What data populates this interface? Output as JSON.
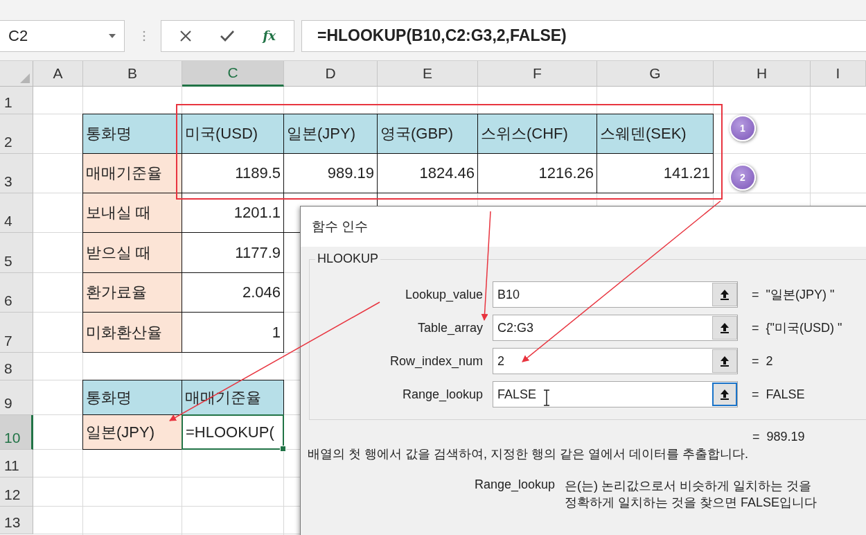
{
  "name_box": "C2",
  "formula_bar": {
    "function_label": "fx",
    "formula": "=HLOOKUP(B10,C2:G3,2,FALSE)"
  },
  "columns": [
    {
      "label": "A",
      "selected": false
    },
    {
      "label": "B",
      "selected": false
    },
    {
      "label": "C",
      "selected": true
    },
    {
      "label": "D",
      "selected": false
    },
    {
      "label": "E",
      "selected": false
    },
    {
      "label": "F",
      "selected": false
    },
    {
      "label": "G",
      "selected": false
    },
    {
      "label": "H",
      "selected": false
    },
    {
      "label": "I",
      "selected": false
    }
  ],
  "rows": [
    {
      "label": "1",
      "selected": false
    },
    {
      "label": "2",
      "selected": false,
      "cells": [
        {
          "kind": "head",
          "text": "통화명"
        },
        {
          "kind": "head",
          "text": "미국(USD)"
        },
        {
          "kind": "head",
          "text": "일본(JPY)"
        },
        {
          "kind": "head",
          "text": "영국(GBP)"
        },
        {
          "kind": "head",
          "text": "스위스(CHF)"
        },
        {
          "kind": "head",
          "text": "스웨덴(SEK)"
        }
      ]
    },
    {
      "label": "3",
      "selected": false,
      "cells": [
        {
          "kind": "label",
          "text": "매매기준율"
        },
        {
          "kind": "number",
          "text": "1189.5"
        },
        {
          "kind": "number",
          "text": "989.19"
        },
        {
          "kind": "number",
          "text": "1824.46"
        },
        {
          "kind": "number",
          "text": "1216.26"
        },
        {
          "kind": "number",
          "text": "141.21"
        }
      ]
    },
    {
      "label": "4",
      "selected": false,
      "cells": [
        {
          "kind": "label",
          "text": "보내실 때"
        },
        {
          "kind": "number",
          "text": "1201.1"
        },
        {
          "kind": "number"
        }
      ]
    },
    {
      "label": "5",
      "selected": false,
      "cells": [
        {
          "kind": "label",
          "text": "받으실 때"
        },
        {
          "kind": "number",
          "text": "1177.9"
        }
      ]
    },
    {
      "label": "6",
      "selected": false,
      "cells": [
        {
          "kind": "label",
          "text": "환가료율"
        },
        {
          "kind": "number",
          "text": "2.046"
        }
      ]
    },
    {
      "label": "7",
      "selected": false,
      "cells": [
        {
          "kind": "label",
          "text": "미화환산율"
        },
        {
          "kind": "number",
          "text": "1"
        }
      ]
    },
    {
      "label": "8",
      "selected": false
    },
    {
      "label": "9",
      "selected": false,
      "cells": [
        {
          "kind": "head",
          "text": "통화명"
        },
        {
          "kind": "head",
          "text": "매매기준율"
        }
      ]
    },
    {
      "label": "10",
      "selected": true,
      "cells": [
        {
          "kind": "label",
          "text": "일본(JPY)"
        },
        {
          "kind": "editing",
          "text": "=HLOOKUP("
        }
      ]
    },
    {
      "label": "11",
      "selected": false
    },
    {
      "label": "12",
      "selected": false
    },
    {
      "label": "13",
      "selected": false
    }
  ],
  "annotations": {
    "markers": [
      "1",
      "2"
    ]
  },
  "dialog": {
    "title": "함수 인수",
    "function": "HLOOKUP",
    "arguments": [
      {
        "label": "Lookup_value",
        "value": "B10",
        "result": "=  \"일본(JPY) \"",
        "focused": false
      },
      {
        "label": "Table_array",
        "value": "C2:G3",
        "result": "=  {\"미국(USD) \"",
        "focused": false
      },
      {
        "label": "Row_index_num",
        "value": "2",
        "result": "=  2",
        "focused": false
      },
      {
        "label": "Range_lookup",
        "value": "FALSE",
        "result": "=  FALSE",
        "focused": true
      }
    ],
    "result": "=  989.19",
    "description": "배열의 첫 행에서 값을 검색하여, 지정한 행의 같은 열에서 데이터를 추출합니다.",
    "help": {
      "name": "Range_lookup",
      "lines": [
        "은(는) 논리값으로서 비슷하게 일치하는 것을",
        "정확하게 일치하는 것을 찾으면 FALSE입니다"
      ]
    }
  }
}
